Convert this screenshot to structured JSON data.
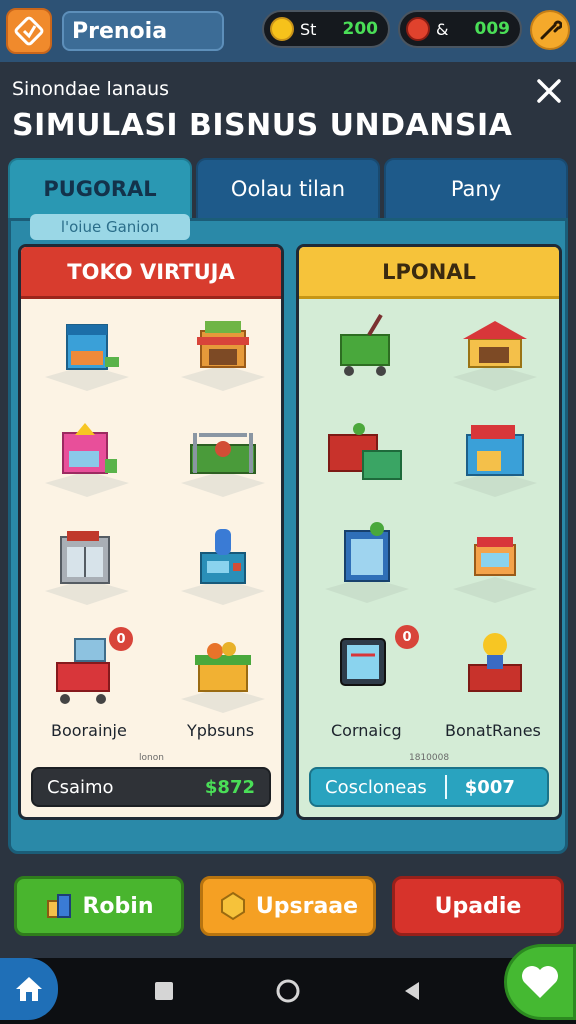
{
  "topbar": {
    "app_name": "Prenoia",
    "coins": {
      "label": "St",
      "value": "200"
    },
    "gems": {
      "label": "&",
      "value": "009"
    }
  },
  "header": {
    "subtitle": "Sinondae lanaus",
    "title": "SIMULASI BISNUS UNDANSIA"
  },
  "tabs": [
    {
      "label": "PUGORAL",
      "active": true
    },
    {
      "label": "Oolau tilan",
      "active": false
    },
    {
      "label": "Pany",
      "active": false
    }
  ],
  "panel": {
    "badge": "l'oiue Ganion"
  },
  "cards": {
    "left": {
      "title": "TOKO VIRTUJA",
      "item_left": "Boorainje",
      "item_right": "Ypbsuns",
      "tiny": "lonon",
      "price_label": "Csaimo",
      "price_value": "$872",
      "notification": "0"
    },
    "right": {
      "title": "LPONAL",
      "item_left": "Cornaicg",
      "item_right": "BonatRanes",
      "tiny": "1810008",
      "price_label": "Coscloneas",
      "price_value": "$007",
      "notification": "0"
    }
  },
  "actions": {
    "green": "Robin",
    "orange": "Upsraae",
    "red": "Upadie"
  },
  "colors": {
    "topbar": "#2d5275",
    "accent_green": "#4ade57",
    "red": "#d83c2e",
    "yellow": "#f6c33a"
  }
}
